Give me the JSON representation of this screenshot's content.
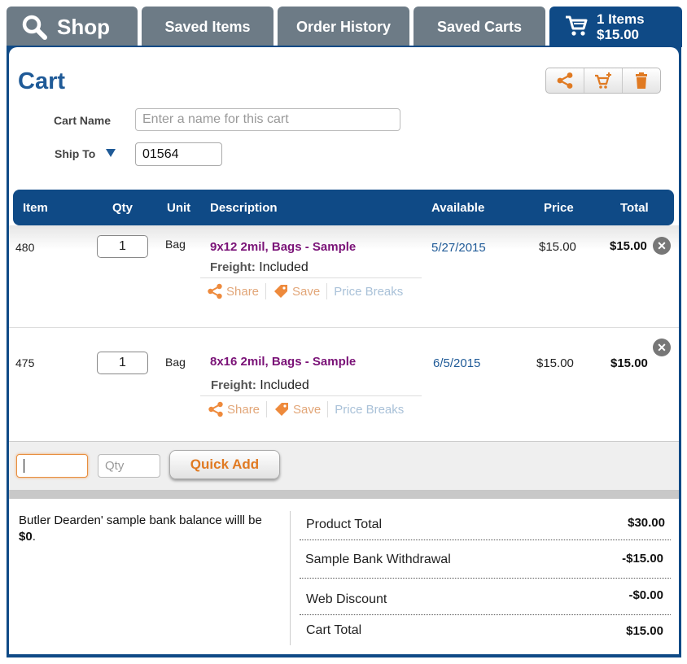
{
  "tabs": {
    "shop": "Shop",
    "saved_items": "Saved Items",
    "order_history": "Order History",
    "saved_carts": "Saved Carts",
    "cart_count": "1 Items",
    "cart_total": "$15.00"
  },
  "cart": {
    "title": "Cart",
    "cart_name_label": "Cart Name",
    "cart_name_placeholder": "Enter a name for this cart",
    "ship_to_label": "Ship To",
    "ship_to_value": "01564"
  },
  "table": {
    "headers": {
      "item": "Item",
      "qty": "Qty",
      "unit": "Unit",
      "description": "Description",
      "available": "Available",
      "price": "Price",
      "total": "Total"
    },
    "rows": [
      {
        "item": "480",
        "qty": "1",
        "unit": "Bag",
        "description": "9x12 2mil, Bags",
        "sample": "- Sample",
        "freight_label": "Freight:",
        "freight_value": "Included",
        "share": "Share",
        "save": "Save",
        "price_breaks": "Price Breaks",
        "available": "5/27/2015",
        "price": "$15.00",
        "total": "$15.00"
      },
      {
        "item": "475",
        "qty": "1",
        "unit": "Bag",
        "description": "8x16 2mil, Bags",
        "sample": "- Sample",
        "freight_label": "Freight:",
        "freight_value": "Included",
        "share": "Share",
        "save": "Save",
        "price_breaks": "Price Breaks",
        "available": "6/5/2015",
        "price": "$15.00",
        "total": "$15.00"
      }
    ]
  },
  "quick_add": {
    "qty_placeholder": "Qty",
    "button": "Quick Add"
  },
  "summary": {
    "bank_note_text": "Butler Dearden' sample bank balance willl be ",
    "bank_note_amount": "$0",
    "bank_note_end": ".",
    "product_total_label": "Product Total",
    "product_total_value": "$30.00",
    "bank_withdrawal_label": "Sample Bank Withdrawal",
    "bank_withdrawal_value": "-$15.00",
    "web_discount_label": "Web Discount",
    "web_discount_value": "-$0.00",
    "cart_total_label": "Cart Total",
    "cart_total_value": "$15.00"
  },
  "colors": {
    "brand_blue": "#0f4a86",
    "tab_gray": "#6d7b86",
    "accent_orange": "#e07a22",
    "product_purple": "#7a1277"
  }
}
